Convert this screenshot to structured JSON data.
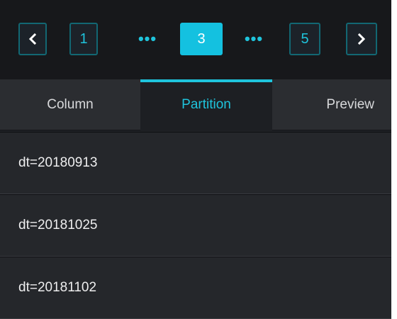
{
  "pagination": {
    "prev_icon": "chevron-left-icon",
    "next_icon": "chevron-right-icon",
    "first_page": "1",
    "current_page": "3",
    "last_page": "5",
    "ellipsis": "•••",
    "accent_color": "#1fc4dc"
  },
  "tabs": [
    {
      "label": "Column",
      "active": false
    },
    {
      "label": "Partition",
      "active": true
    },
    {
      "label": "Preview",
      "active": false
    }
  ],
  "partitions": [
    {
      "label": "dt=20180913"
    },
    {
      "label": "dt=20181025"
    },
    {
      "label": "dt=20181102"
    }
  ]
}
